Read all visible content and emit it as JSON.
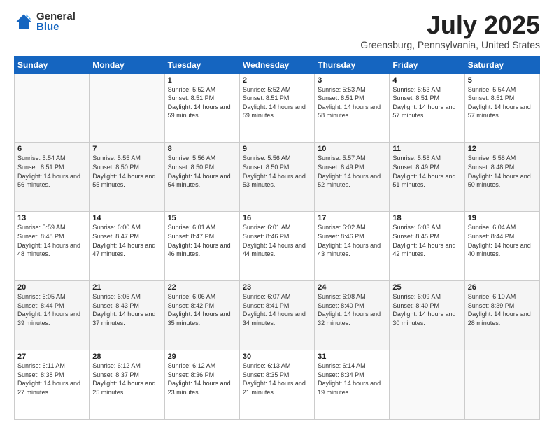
{
  "logo": {
    "general": "General",
    "blue": "Blue"
  },
  "title": "July 2025",
  "location": "Greensburg, Pennsylvania, United States",
  "headers": [
    "Sunday",
    "Monday",
    "Tuesday",
    "Wednesday",
    "Thursday",
    "Friday",
    "Saturday"
  ],
  "weeks": [
    [
      {
        "day": "",
        "info": ""
      },
      {
        "day": "",
        "info": ""
      },
      {
        "day": "1",
        "info": "Sunrise: 5:52 AM\nSunset: 8:51 PM\nDaylight: 14 hours and 59 minutes."
      },
      {
        "day": "2",
        "info": "Sunrise: 5:52 AM\nSunset: 8:51 PM\nDaylight: 14 hours and 59 minutes."
      },
      {
        "day": "3",
        "info": "Sunrise: 5:53 AM\nSunset: 8:51 PM\nDaylight: 14 hours and 58 minutes."
      },
      {
        "day": "4",
        "info": "Sunrise: 5:53 AM\nSunset: 8:51 PM\nDaylight: 14 hours and 57 minutes."
      },
      {
        "day": "5",
        "info": "Sunrise: 5:54 AM\nSunset: 8:51 PM\nDaylight: 14 hours and 57 minutes."
      }
    ],
    [
      {
        "day": "6",
        "info": "Sunrise: 5:54 AM\nSunset: 8:51 PM\nDaylight: 14 hours and 56 minutes."
      },
      {
        "day": "7",
        "info": "Sunrise: 5:55 AM\nSunset: 8:50 PM\nDaylight: 14 hours and 55 minutes."
      },
      {
        "day": "8",
        "info": "Sunrise: 5:56 AM\nSunset: 8:50 PM\nDaylight: 14 hours and 54 minutes."
      },
      {
        "day": "9",
        "info": "Sunrise: 5:56 AM\nSunset: 8:50 PM\nDaylight: 14 hours and 53 minutes."
      },
      {
        "day": "10",
        "info": "Sunrise: 5:57 AM\nSunset: 8:49 PM\nDaylight: 14 hours and 52 minutes."
      },
      {
        "day": "11",
        "info": "Sunrise: 5:58 AM\nSunset: 8:49 PM\nDaylight: 14 hours and 51 minutes."
      },
      {
        "day": "12",
        "info": "Sunrise: 5:58 AM\nSunset: 8:48 PM\nDaylight: 14 hours and 50 minutes."
      }
    ],
    [
      {
        "day": "13",
        "info": "Sunrise: 5:59 AM\nSunset: 8:48 PM\nDaylight: 14 hours and 48 minutes."
      },
      {
        "day": "14",
        "info": "Sunrise: 6:00 AM\nSunset: 8:47 PM\nDaylight: 14 hours and 47 minutes."
      },
      {
        "day": "15",
        "info": "Sunrise: 6:01 AM\nSunset: 8:47 PM\nDaylight: 14 hours and 46 minutes."
      },
      {
        "day": "16",
        "info": "Sunrise: 6:01 AM\nSunset: 8:46 PM\nDaylight: 14 hours and 44 minutes."
      },
      {
        "day": "17",
        "info": "Sunrise: 6:02 AM\nSunset: 8:46 PM\nDaylight: 14 hours and 43 minutes."
      },
      {
        "day": "18",
        "info": "Sunrise: 6:03 AM\nSunset: 8:45 PM\nDaylight: 14 hours and 42 minutes."
      },
      {
        "day": "19",
        "info": "Sunrise: 6:04 AM\nSunset: 8:44 PM\nDaylight: 14 hours and 40 minutes."
      }
    ],
    [
      {
        "day": "20",
        "info": "Sunrise: 6:05 AM\nSunset: 8:44 PM\nDaylight: 14 hours and 39 minutes."
      },
      {
        "day": "21",
        "info": "Sunrise: 6:05 AM\nSunset: 8:43 PM\nDaylight: 14 hours and 37 minutes."
      },
      {
        "day": "22",
        "info": "Sunrise: 6:06 AM\nSunset: 8:42 PM\nDaylight: 14 hours and 35 minutes."
      },
      {
        "day": "23",
        "info": "Sunrise: 6:07 AM\nSunset: 8:41 PM\nDaylight: 14 hours and 34 minutes."
      },
      {
        "day": "24",
        "info": "Sunrise: 6:08 AM\nSunset: 8:40 PM\nDaylight: 14 hours and 32 minutes."
      },
      {
        "day": "25",
        "info": "Sunrise: 6:09 AM\nSunset: 8:40 PM\nDaylight: 14 hours and 30 minutes."
      },
      {
        "day": "26",
        "info": "Sunrise: 6:10 AM\nSunset: 8:39 PM\nDaylight: 14 hours and 28 minutes."
      }
    ],
    [
      {
        "day": "27",
        "info": "Sunrise: 6:11 AM\nSunset: 8:38 PM\nDaylight: 14 hours and 27 minutes."
      },
      {
        "day": "28",
        "info": "Sunrise: 6:12 AM\nSunset: 8:37 PM\nDaylight: 14 hours and 25 minutes."
      },
      {
        "day": "29",
        "info": "Sunrise: 6:12 AM\nSunset: 8:36 PM\nDaylight: 14 hours and 23 minutes."
      },
      {
        "day": "30",
        "info": "Sunrise: 6:13 AM\nSunset: 8:35 PM\nDaylight: 14 hours and 21 minutes."
      },
      {
        "day": "31",
        "info": "Sunrise: 6:14 AM\nSunset: 8:34 PM\nDaylight: 14 hours and 19 minutes."
      },
      {
        "day": "",
        "info": ""
      },
      {
        "day": "",
        "info": ""
      }
    ]
  ]
}
